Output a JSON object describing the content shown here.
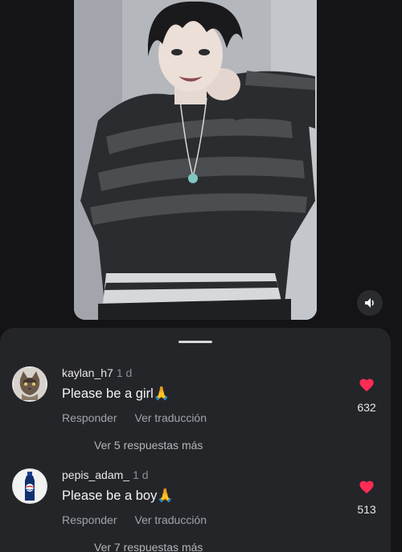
{
  "video": {
    "volume_icon": "speaker-icon"
  },
  "comments": [
    {
      "avatar_icon": "cat-avatar",
      "username": "kaylan_h7",
      "time": "1 d",
      "text": "Please be a girl🙏",
      "reply_label": "Responder",
      "translate_label": "Ver traducción",
      "likes": "632",
      "more_replies": "Ver 5 respuestas más"
    },
    {
      "avatar_icon": "pepsi-bottle-avatar",
      "username": "pepis_adam_",
      "time": "1 d",
      "text": "Please be a boy🙏",
      "reply_label": "Responder",
      "translate_label": "Ver traducción",
      "likes": "513",
      "more_replies": "Ver 7 respuestas más"
    }
  ],
  "colors": {
    "like_heart": "#fe2c55",
    "sheet_bg": "#242529"
  }
}
